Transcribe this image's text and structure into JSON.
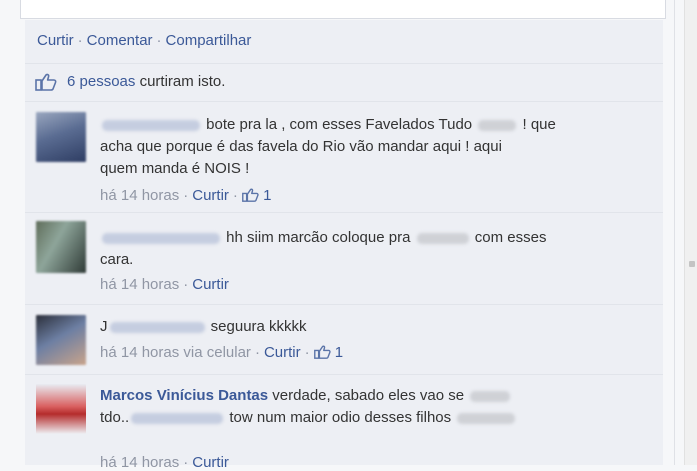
{
  "actions": {
    "like": "Curtir",
    "comment": "Comentar",
    "share": "Compartilhar"
  },
  "likes": {
    "count_text": "6 pessoas",
    "suffix": "curtiram isto."
  },
  "comments": [
    {
      "line1": "bote pra la , com esses Favelados Tudo",
      "line1b": "! que",
      "line2": "acha que porque é das favela do Rio vão mandar aqui ! aqui",
      "line3": "quem manda é NOIS !",
      "time": "há 14 horas",
      "like": "Curtir",
      "like_count": "1"
    },
    {
      "line1": "hh siim marcão coloque pra",
      "line1b": "com esses",
      "line2": "cara.",
      "time": "há 14 horas",
      "like": "Curtir"
    },
    {
      "lead": "J",
      "line1": "seguura kkkkk",
      "time": "há 14 horas via celular",
      "like": "Curtir",
      "like_count": "1"
    },
    {
      "author": "Marcos Vinícius Dantas",
      "line1": "verdade, sabado eles vao se",
      "line2a": "tdo..",
      "line2b": "tow num maior odio desses filhos",
      "time": "há 14 horas",
      "like": "Curtir"
    }
  ]
}
